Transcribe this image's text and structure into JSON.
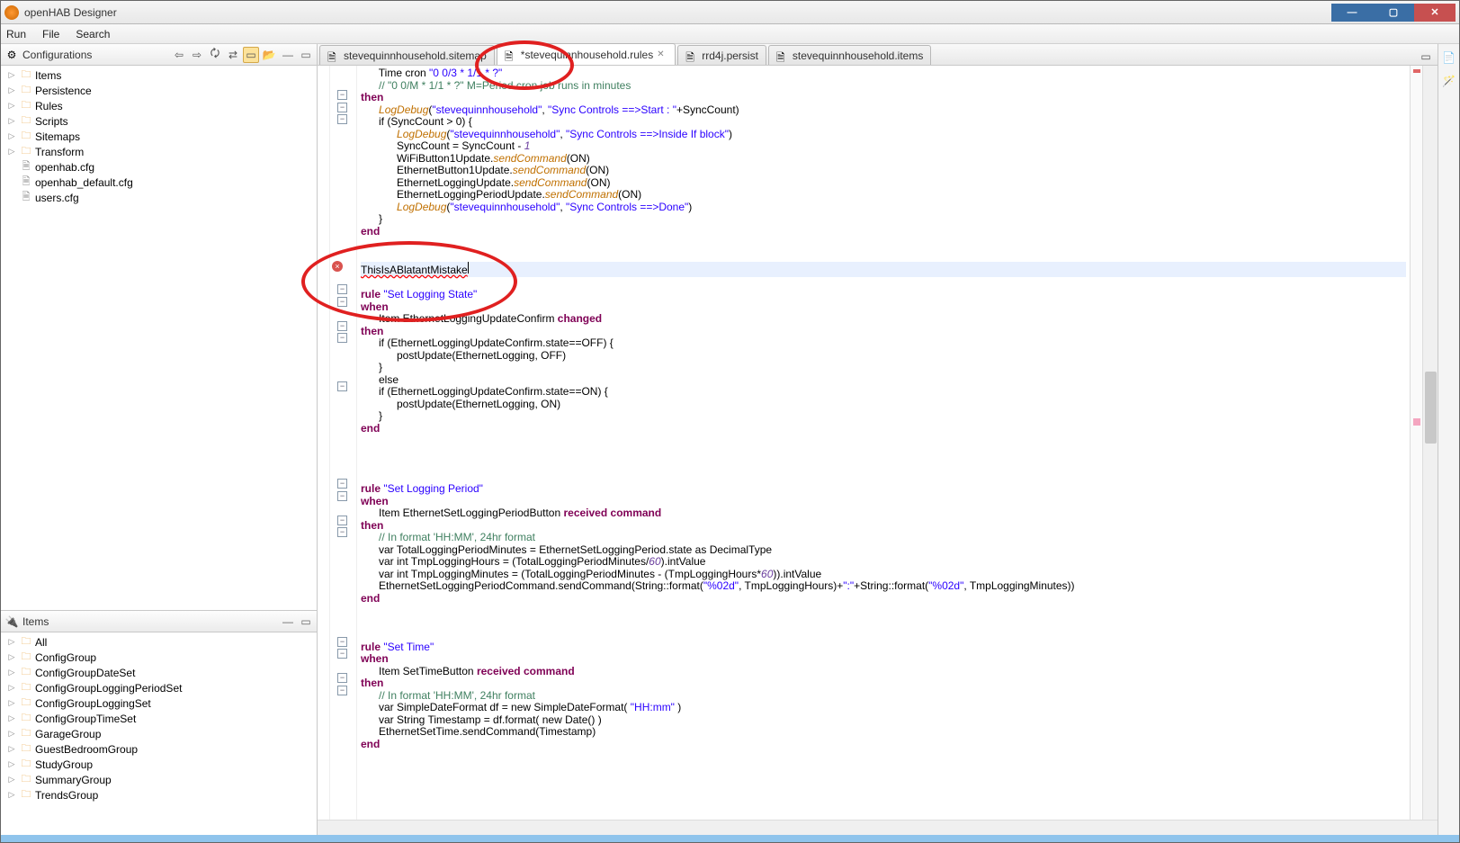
{
  "window": {
    "title": "openHAB Designer"
  },
  "menu": {
    "run": "Run",
    "file": "File",
    "search": "Search"
  },
  "configurations": {
    "title": "Configurations",
    "tree": [
      {
        "label": "Items",
        "icon": "folder",
        "expandable": true
      },
      {
        "label": "Persistence",
        "icon": "folder",
        "expandable": true
      },
      {
        "label": "Rules",
        "icon": "folder",
        "expandable": true
      },
      {
        "label": "Scripts",
        "icon": "folder",
        "expandable": true
      },
      {
        "label": "Sitemaps",
        "icon": "folder",
        "expandable": true
      },
      {
        "label": "Transform",
        "icon": "folder",
        "expandable": true
      },
      {
        "label": "openhab.cfg",
        "icon": "file",
        "expandable": false
      },
      {
        "label": "openhab_default.cfg",
        "icon": "file",
        "expandable": false
      },
      {
        "label": "users.cfg",
        "icon": "file",
        "expandable": false
      }
    ]
  },
  "items_panel": {
    "title": "Items",
    "tree": [
      {
        "label": "All"
      },
      {
        "label": "ConfigGroup"
      },
      {
        "label": "ConfigGroupDateSet"
      },
      {
        "label": "ConfigGroupLoggingPeriodSet"
      },
      {
        "label": "ConfigGroupLoggingSet"
      },
      {
        "label": "ConfigGroupTimeSet"
      },
      {
        "label": "GarageGroup"
      },
      {
        "label": "GuestBedroomGroup"
      },
      {
        "label": "StudyGroup"
      },
      {
        "label": "SummaryGroup"
      },
      {
        "label": "TrendsGroup"
      }
    ]
  },
  "tabs": [
    {
      "label": "stevequinnhousehold.sitemap",
      "active": false
    },
    {
      "label": "*stevequinnhousehold.rules",
      "active": true
    },
    {
      "label": "rrd4j.persist",
      "active": false
    },
    {
      "label": "stevequinnhousehold.items",
      "active": false
    }
  ],
  "code_lines": [
    {
      "t": "      Time cron ",
      "s1": "\"0 0/3 * 1/1 * ?\""
    },
    {
      "cmt": "      // \"0 0/M * 1/1 * ?\" M=Period cron job runs in minutes"
    },
    {
      "kw": "then"
    },
    {
      "t": "      ",
      "fn": "LogDebug",
      "p": "(",
      "s1": "\"stevequinnhousehold\"",
      "c1": ", ",
      "s2": "\"Sync Controls ==>Start : \"",
      "c2": "+SyncCount)"
    },
    {
      "t": "      if (SyncCount > 0) {"
    },
    {
      "t": "            ",
      "fn": "LogDebug",
      "p": "(",
      "s1": "\"stevequinnhousehold\"",
      "c1": ", ",
      "s2": "\"Sync Controls ==>Inside If block\"",
      "c2": ")"
    },
    {
      "t": "            SyncCount = SyncCount - ",
      "mv": "1"
    },
    {
      "t": "            WiFiButton1Update.",
      "fn": "sendCommand",
      "c2": "(ON)"
    },
    {
      "t": "            EthernetButton1Update.",
      "fn": "sendCommand",
      "c2": "(ON)"
    },
    {
      "t": "            EthernetLoggingUpdate.",
      "fn": "sendCommand",
      "c2": "(ON)"
    },
    {
      "t": "            EthernetLoggingPeriodUpdate.",
      "fn": "sendCommand",
      "c2": "(ON)"
    },
    {
      "t": "            ",
      "fn": "LogDebug",
      "p": "(",
      "s1": "\"stevequinnhousehold\"",
      "c1": ", ",
      "s2": "\"Sync Controls ==>Done\"",
      "c2": ")"
    },
    {
      "t": "      }"
    },
    {
      "kw": "end"
    },
    {
      "blank": true
    },
    {
      "blank": true
    },
    {
      "err": "ThisIsABlatantMistake"
    },
    {
      "blank": true
    },
    {
      "kw": "rule",
      "s1": " \"Set Logging State\""
    },
    {
      "kw": "when"
    },
    {
      "t": "      Item EthernetLoggingUpdateConfirm ",
      "kw2": "changed"
    },
    {
      "kw": "then"
    },
    {
      "t": "      if (EthernetLoggingUpdateConfirm.state==OFF) {"
    },
    {
      "t": "            postUpdate(EthernetLogging, OFF)"
    },
    {
      "t": "      }"
    },
    {
      "t": "      else"
    },
    {
      "t": "      if (EthernetLoggingUpdateConfirm.state==ON) {"
    },
    {
      "t": "            postUpdate(EthernetLogging, ON)"
    },
    {
      "t": "      }"
    },
    {
      "kw": "end"
    },
    {
      "blank": true
    },
    {
      "blank": true
    },
    {
      "blank": true
    },
    {
      "blank": true
    },
    {
      "kw": "rule",
      "s1": " \"Set Logging Period\""
    },
    {
      "kw": "when"
    },
    {
      "t": "      Item EthernetSetLoggingPeriodButton ",
      "kw2": "received command"
    },
    {
      "kw": "then"
    },
    {
      "cmt": "      // In format 'HH:MM', 24hr format"
    },
    {
      "t": "      var TotalLoggingPeriodMinutes = EthernetSetLoggingPeriod.state as DecimalType"
    },
    {
      "t": "      var int TmpLoggingHours = (TotalLoggingPeriodMinutes/",
      "mv": "60",
      "c2": ").intValue"
    },
    {
      "t": "      var int TmpLoggingMinutes = (TotalLoggingPeriodMinutes - (TmpLoggingHours*",
      "mv": "60",
      "c2": ")).intValue"
    },
    {
      "t": "      EthernetSetLoggingPeriodCommand.sendCommand(String::format(",
      "s1": "\"%02d\"",
      "c1": ", TmpLoggingHours)+",
      "s2": "\":\"",
      "c2": "+String::format(",
      "s3": "\"%02d\"",
      "c3": ", TmpLoggingMinutes))"
    },
    {
      "kw": "end"
    },
    {
      "blank": true
    },
    {
      "blank": true
    },
    {
      "blank": true
    },
    {
      "kw": "rule",
      "s1": " \"Set Time\""
    },
    {
      "kw": "when"
    },
    {
      "t": "      Item SetTimeButton ",
      "kw2": "received command"
    },
    {
      "kw": "then"
    },
    {
      "cmt": "      // In format 'HH:MM', 24hr format"
    },
    {
      "t": "      var SimpleDateFormat df = new SimpleDateFormat( ",
      "s1": "\"HH:mm\"",
      "c2": " )"
    },
    {
      "t": "      var String Timestamp = df.format( new Date() )"
    },
    {
      "t": "      EthernetSetTime.sendCommand(Timestamp)"
    },
    {
      "kw2": "end"
    }
  ]
}
